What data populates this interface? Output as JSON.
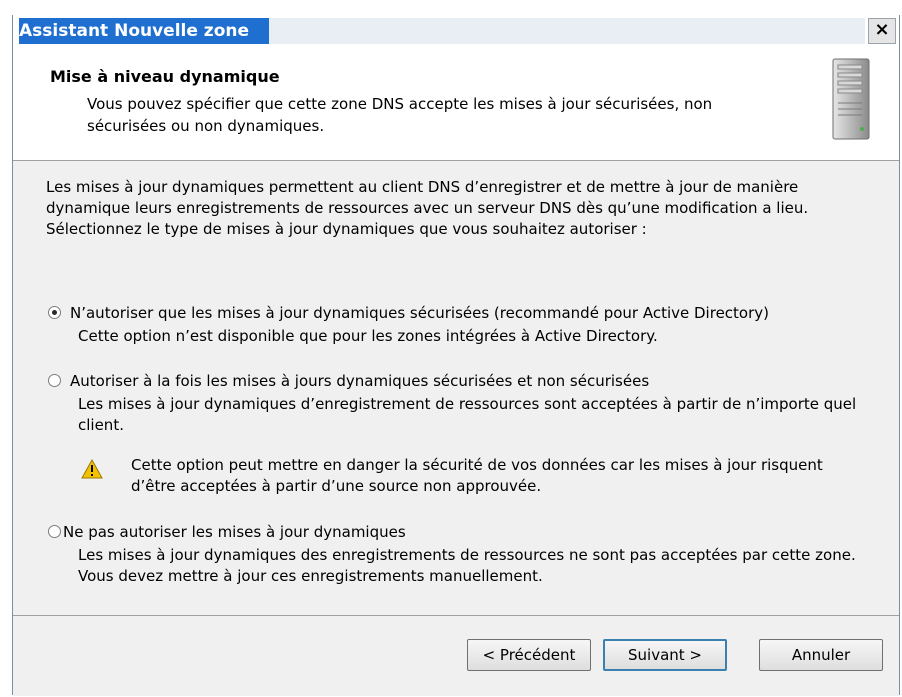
{
  "window": {
    "title": "Assistant Nouvelle zone",
    "close_glyph": "×"
  },
  "header": {
    "title": "Mise à niveau dynamique",
    "subtitle": "Vous pouvez spécifier que cette zone DNS accepte les mises à jour sécurisées, non sécurisées ou non dynamiques.",
    "icon": "server-icon"
  },
  "body": {
    "intro": "Les mises à jour dynamiques permettent au client DNS d’enregistrer et de mettre à jour de manière dynamique leurs enregistrements de ressources avec un serveur DNS dès qu’une modification a lieu.",
    "prompt": "Sélectionnez le type de mises à jour dynamiques que vous souhaitez autoriser :",
    "options": [
      {
        "label": "N’autoriser que les mises à jour dynamiques sécurisées (recommandé pour Active Directory)",
        "description": "Cette option n’est disponible que pour les zones intégrées à Active Directory.",
        "checked": true
      },
      {
        "label": "Autoriser à la fois les mises à jours dynamiques sécurisées et non sécurisées",
        "description": "Les mises à jour dynamiques d’enregistrement de ressources sont acceptées à partir de n’importe quel client.",
        "warning": "Cette option peut mettre en danger la sécurité de vos données car les mises à jour risquent d’être acceptées à partir d’une source non approuvée.",
        "checked": false
      },
      {
        "label": "Ne pas autoriser les mises à jour dynamiques",
        "description": "Les mises à jour dynamiques des enregistrements de ressources ne sont pas acceptées par cette zone. Vous devez mettre à jour ces enregistrements manuellement.",
        "checked": false
      }
    ]
  },
  "footer": {
    "back_label": "< Précédent",
    "next_label": "Suivant >",
    "cancel_label": "Annuler"
  },
  "colors": {
    "titlebar": "#1f6fd1",
    "body_bg": "#f0f0f0",
    "warning": "#f2c200"
  }
}
